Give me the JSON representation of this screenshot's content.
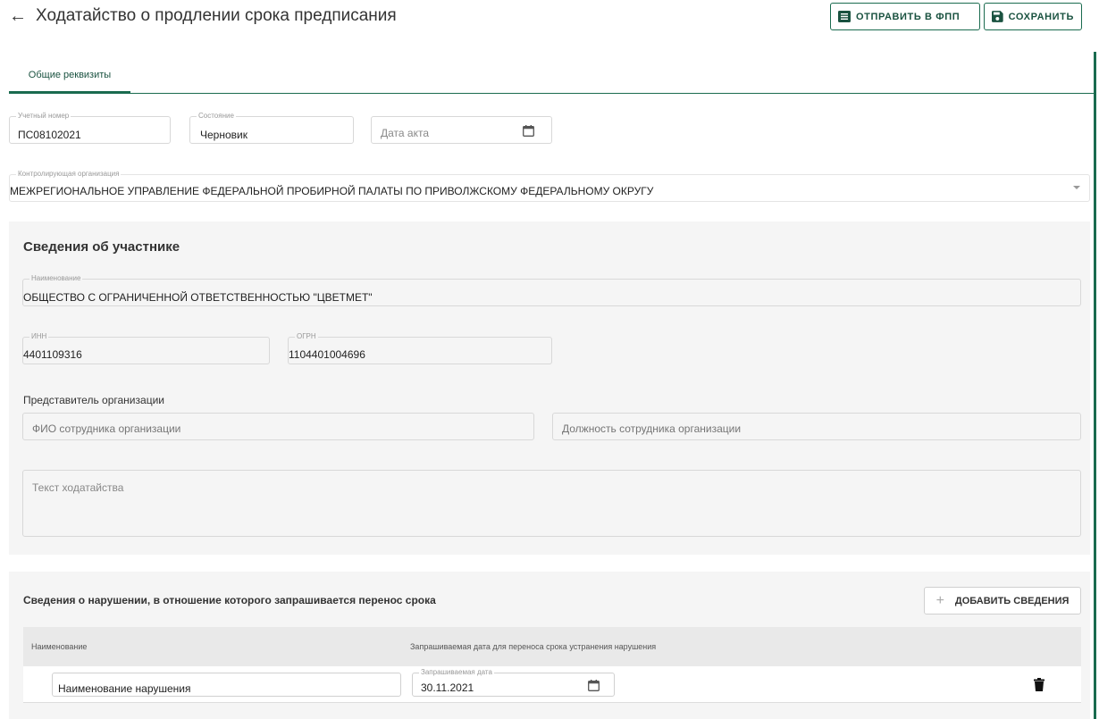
{
  "header": {
    "title": "Ходатайство о продлении срока предписания",
    "send_label": "ОТПРАВИТЬ В ФПП",
    "save_label": "СОХРАНИТЬ"
  },
  "tabs": [
    {
      "label": "Общие реквизиты",
      "active": true
    }
  ],
  "form": {
    "account_number": {
      "label": "Учетный номер",
      "value": "ПС08102021"
    },
    "status": {
      "label": "Состояние",
      "value": "Черновик"
    },
    "act_date": {
      "placeholder": "Дата акта"
    },
    "controlling_org": {
      "label": "Контролирующая организация",
      "value": "МЕЖРЕГИОНАЛЬНОЕ УПРАВЛЕНИЕ ФЕДЕРАЛЬНОЙ ПРОБИРНОЙ ПАЛАТЫ ПО ПРИВОЛЖСКОМУ ФЕДЕРАЛЬНОМУ ОКРУГУ"
    }
  },
  "participant": {
    "section_title": "Сведения об участнике",
    "name": {
      "label": "Наименование",
      "value": "ОБЩЕСТВО С ОГРАНИЧЕННОЙ ОТВЕТСТВЕННОСТЬЮ \"ЦВЕТМЕТ\""
    },
    "inn": {
      "label": "ИНН",
      "value": "4401109316"
    },
    "ogrn": {
      "label": "ОГРН",
      "value": "1104401004696"
    },
    "representative_label": "Представитель организации",
    "employee_name_placeholder": "ФИО сотрудника организации",
    "employee_position_placeholder": "Должность сотрудника организации",
    "petition_text_placeholder": "Текст ходатайства"
  },
  "violations": {
    "section_title": "Сведения о нарушении, в отношение которого запрашивается перенос срока",
    "add_label": "ДОБАВИТЬ СВЕДЕНИЯ",
    "columns": [
      "Наименование",
      "Запрашиваемая дата для переноса срока устранения нарушения"
    ],
    "rows": [
      {
        "name": "Наименование нарушения",
        "date_label": "Запрашиваемая дата",
        "date": "30.11.2021"
      }
    ]
  },
  "colors": {
    "accent": "#1a6b4f",
    "panel": "#f5f5f5"
  }
}
